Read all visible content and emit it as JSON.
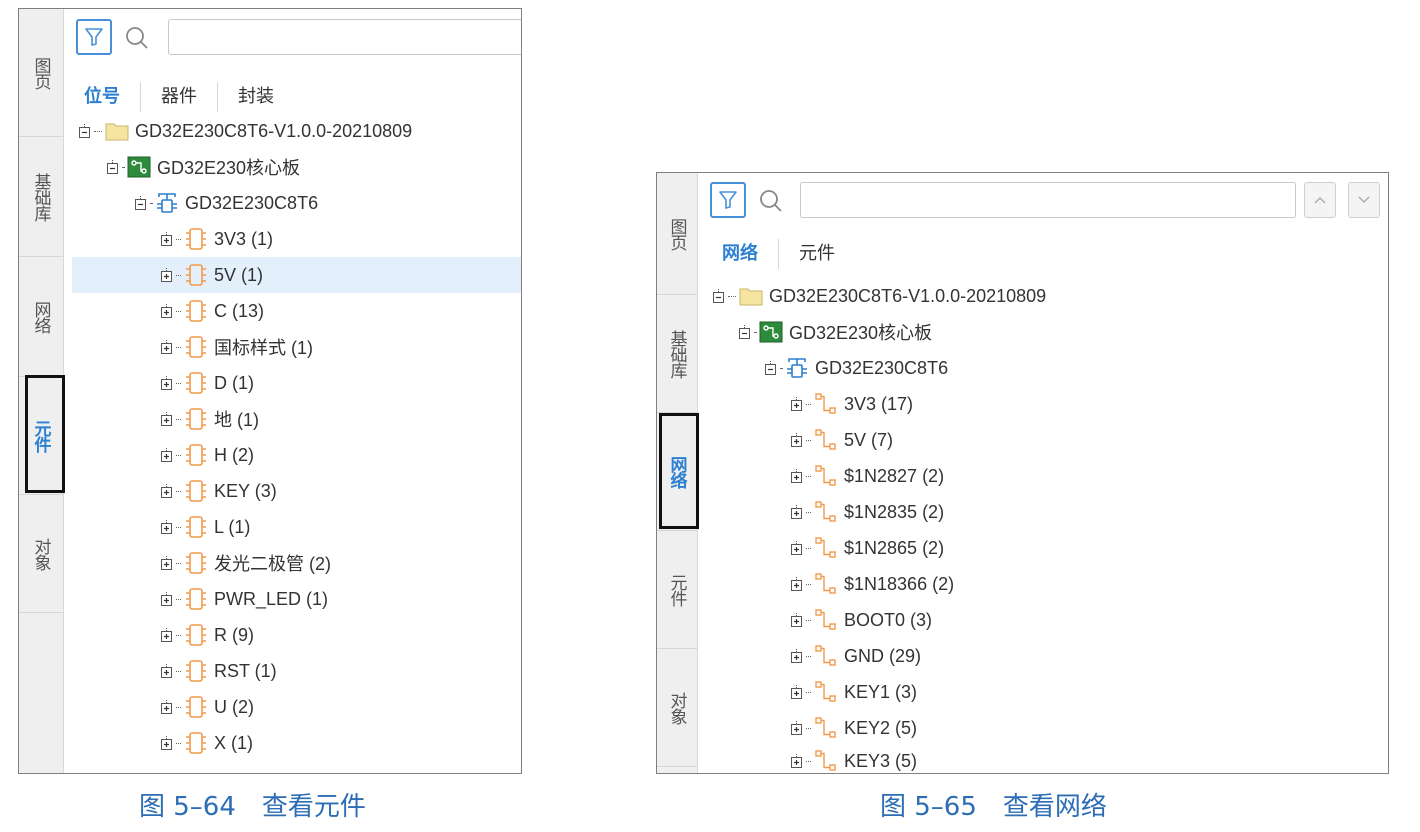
{
  "colors": {
    "accent": "#2c7fd1",
    "folder": "#f6e4a1",
    "board": "#2e8b3c",
    "component": "#f39a4a",
    "net": "#f39a4a",
    "selected_row": "#e3f0fb"
  },
  "left": {
    "side_tabs": [
      "图页",
      "基础库",
      "网络",
      "元件",
      "对象"
    ],
    "active_side_tab": "元件",
    "view_tabs": [
      "位号",
      "器件",
      "封装"
    ],
    "active_view_tab": "位号",
    "search_value": "",
    "project": "GD32E230C8T6-V1.0.0-20210809",
    "board": "GD32E230核心板",
    "schematic": "GD32E230C8T6",
    "items": [
      "3V3 (1)",
      "5V (1)",
      "C (13)",
      "国标样式 (1)",
      "D (1)",
      "地 (1)",
      "H (2)",
      "KEY (3)",
      "L (1)",
      "发光二极管 (2)",
      "PWR_LED (1)",
      "R (9)",
      "RST (1)",
      "U (2)",
      "X (1)"
    ],
    "selected_item": "5V (1)",
    "caption": "图 5–64　查看元件"
  },
  "right": {
    "side_tabs": [
      "图页",
      "基础库",
      "网络",
      "元件",
      "对象"
    ],
    "active_side_tab": "网络",
    "view_tabs": [
      "网络",
      "元件"
    ],
    "active_view_tab": "网络",
    "search_value": "",
    "project": "GD32E230C8T6-V1.0.0-20210809",
    "board": "GD32E230核心板",
    "schematic": "GD32E230C8T6",
    "items": [
      "3V3 (17)",
      "5V (7)",
      "$1N2827 (2)",
      "$1N2835 (2)",
      "$1N2865 (2)",
      "$1N18366 (2)",
      "BOOT0 (3)",
      "GND (29)",
      "KEY1 (3)",
      "KEY2 (5)",
      "KEY3 (5)"
    ],
    "caption": "图 5–65　查看网络"
  }
}
